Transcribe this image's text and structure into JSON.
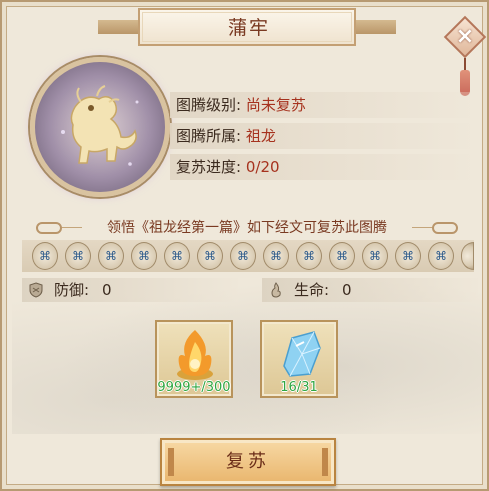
{
  "title": "蒲牢",
  "info": [
    {
      "label": "图腾级别:",
      "value": "尚未复苏"
    },
    {
      "label": "图腾所属:",
      "value": "祖龙"
    },
    {
      "label": "复苏进度:",
      "value": "0/20"
    }
  ],
  "divider_text": "领悟《祖龙经第一篇》如下经文可复苏此图腾",
  "stats": {
    "defense": {
      "label": "防御:",
      "value": "0"
    },
    "life": {
      "label": "生命:",
      "value": "0"
    }
  },
  "materials": [
    {
      "icon": "flame-orb-icon",
      "count": "9999+/300"
    },
    {
      "icon": "blue-crystal-icon",
      "count": "16/31"
    }
  ],
  "revive_label": "复苏",
  "colors": {
    "title": "#7a3a22",
    "value_red": "#a6321e",
    "count_green": "#2fa640",
    "button": "#e9b56c"
  }
}
